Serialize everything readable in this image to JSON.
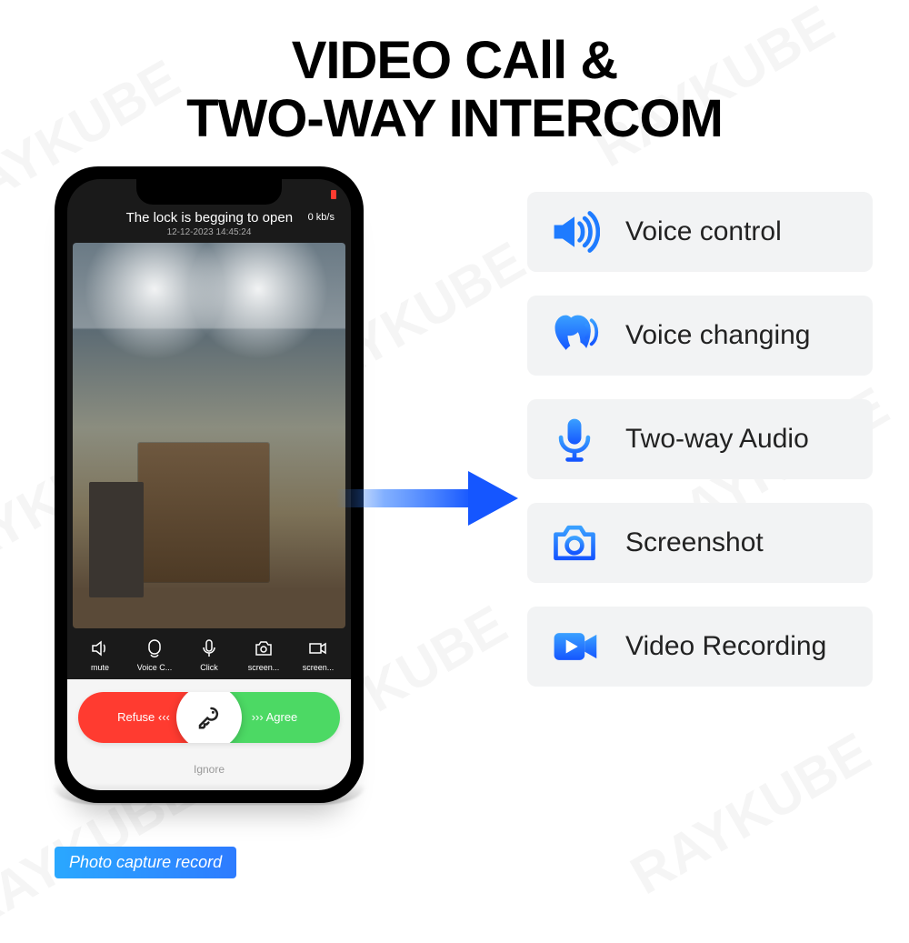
{
  "title_line1": "VIDEO CAll &",
  "title_line2": "TWO-WAY INTERCOM",
  "watermark": "RAYKUBE",
  "phone": {
    "header": "The lock is begging to open",
    "kbs": "0 kb/s",
    "timestamp": "12-12-2023 14:45:24",
    "toolbar": {
      "mute": "mute",
      "voice_change": "Voice C...",
      "click": "Click",
      "screenshot": "screen...",
      "screen_record": "screen..."
    },
    "refuse": "Refuse ‹‹‹",
    "agree": "››› Agree",
    "ignore": "Ignore"
  },
  "capture_badge": "Photo capture record",
  "features": [
    {
      "icon": "volume",
      "label": "Voice control"
    },
    {
      "icon": "voice-change",
      "label": "Voice changing"
    },
    {
      "icon": "mic",
      "label": "Two-way Audio"
    },
    {
      "icon": "camera",
      "label": "Screenshot"
    },
    {
      "icon": "video",
      "label": "Video Recording"
    }
  ]
}
